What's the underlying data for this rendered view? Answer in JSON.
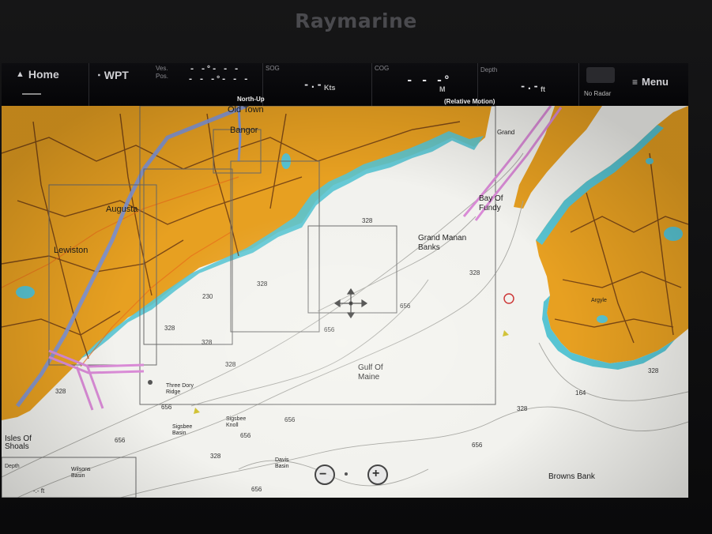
{
  "device": {
    "brand": "Raymarine"
  },
  "toolbar": {
    "home_label": "Home",
    "wpt_label": "WPT",
    "ves_pos_label": "Ves.\nPos.",
    "ves_pos_line1": "- -°- - -",
    "ves_pos_line2": "- - -°- - -",
    "sog_label": "SOG",
    "sog_value": "-.-",
    "sog_unit": "Kts",
    "cog_label": "COG",
    "cog_value": "- - -°",
    "cog_unit": "M",
    "depth_label": "Depth",
    "depth_value": "-.-",
    "depth_unit": "ft",
    "radar_status": "No Radar",
    "menu_label": "Menu",
    "orientation": "North-Up",
    "motion_mode": "(Relative Motion)"
  },
  "chart": {
    "labels": {
      "old_town": "Old Town",
      "bangor": "Bangor",
      "augusta": "Augusta",
      "lewiston": "Lewiston",
      "bay_of_fundy": "Bay Of\nFundy",
      "grand_manan_banks": "Grand Manan\nBanks",
      "gulf_of_maine": "Gulf Of\nMaine",
      "browns_bank": "Browns Bank",
      "isles_of_shoals": "Isles Of\nShoals",
      "three_dory_ridge": "Three Dory\nRidge",
      "sigsbee_basin": "Sigsbee\nBasin",
      "sigsbee_knoll": "Sigsbee\nKnoll",
      "davis_basin": "Davis\nBasin",
      "wilsons_basin": "Wilsons\nBasin",
      "grand": "Grand",
      "argyle": "Argyle"
    },
    "depths": [
      "328",
      "328",
      "328",
      "328",
      "328",
      "328",
      "328",
      "328",
      "328",
      "328",
      "656",
      "656",
      "656",
      "656",
      "656",
      "656",
      "656",
      "656",
      "164",
      "230"
    ],
    "colors": {
      "land": "#e7a021",
      "water": "#f2f2ee",
      "shallow": "#58c4d2",
      "roads": "#6b3a14",
      "river": "#7d94d8",
      "zone": "#d98bd6"
    }
  },
  "bottom_left": {
    "label": "Depth",
    "value": "-.- ft"
  }
}
